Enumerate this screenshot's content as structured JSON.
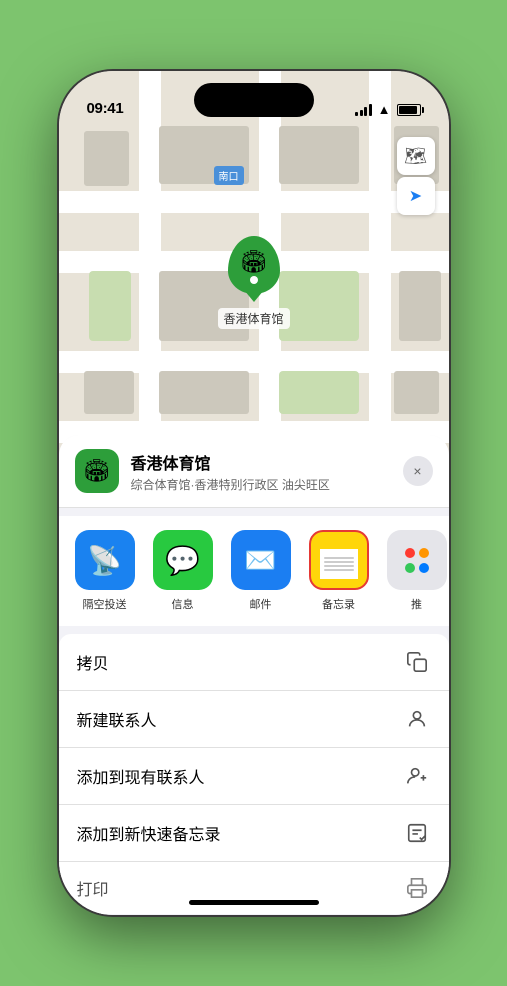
{
  "status_bar": {
    "time": "09:41",
    "location_arrow": "▲"
  },
  "map": {
    "label": "南口",
    "controls": {
      "map_icon": "🗺",
      "location_icon": "➤"
    }
  },
  "venue_marker": {
    "name": "香港体育馆",
    "icon": "🏟"
  },
  "sheet": {
    "header": {
      "venue_name": "香港体育馆",
      "venue_subtitle": "综合体育馆·香港特别行政区 油尖旺区",
      "close_label": "×"
    },
    "share_items": [
      {
        "id": "airdrop",
        "label": "隔空投送",
        "icon": "📡",
        "style": "airdrop"
      },
      {
        "id": "messages",
        "label": "信息",
        "icon": "💬",
        "style": "messages"
      },
      {
        "id": "mail",
        "label": "邮件",
        "icon": "✉️",
        "style": "mail"
      },
      {
        "id": "notes",
        "label": "备忘录",
        "icon": "📋",
        "style": "notes"
      },
      {
        "id": "more",
        "label": "推",
        "icon": "more",
        "style": "more"
      }
    ],
    "actions": [
      {
        "id": "copy",
        "label": "拷贝",
        "icon": "copy"
      },
      {
        "id": "new-contact",
        "label": "新建联系人",
        "icon": "person"
      },
      {
        "id": "add-contact",
        "label": "添加到现有联系人",
        "icon": "person-add"
      },
      {
        "id": "quick-notes",
        "label": "添加到新快速备忘录",
        "icon": "notes"
      },
      {
        "id": "print",
        "label": "打印",
        "icon": "print"
      }
    ]
  },
  "colors": {
    "green": "#2d9e3a",
    "blue": "#1b7ef2",
    "red_border": "#e53935",
    "notes_yellow": "#ffd60a"
  }
}
